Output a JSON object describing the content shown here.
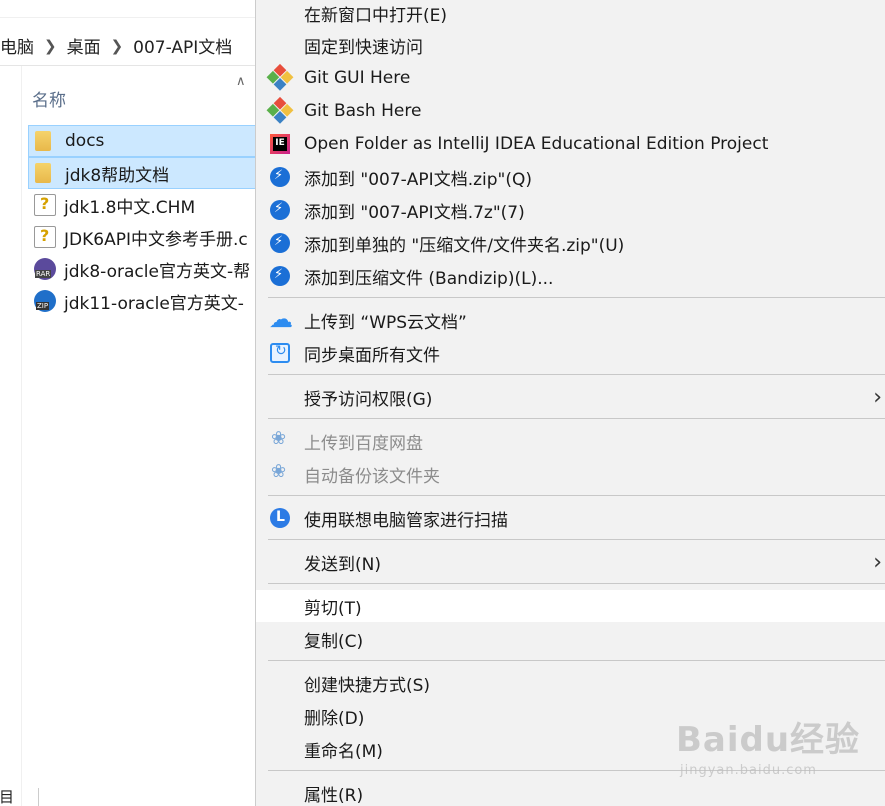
{
  "explorer": {
    "breadcrumb": [
      "电脑",
      "桌面",
      "007-API文档"
    ],
    "column_header": "名称",
    "files": [
      {
        "name": "docs",
        "icon": "folder-icon",
        "selected": true
      },
      {
        "name": "jdk8帮助文档",
        "icon": "folder-icon",
        "selected": true
      },
      {
        "name": "jdk1.8中文.CHM",
        "icon": "chm-file-icon",
        "selected": false
      },
      {
        "name": "JDK6API中文参考手册.c",
        "icon": "chm-file-icon",
        "selected": false
      },
      {
        "name": "jdk8-oracle官方英文-帮",
        "icon": "rar-file-icon",
        "selected": false
      },
      {
        "name": "jdk11-oracle官方英文-",
        "icon": "zip-file-icon",
        "selected": false
      }
    ],
    "status_fragment": "项目"
  },
  "context_menu": {
    "items": [
      {
        "label": "在新窗口中打开(E)",
        "icon": "",
        "disabled": false
      },
      {
        "label": "固定到快速访问",
        "icon": "",
        "disabled": false
      },
      {
        "label": "Git GUI Here",
        "icon": "git-icon",
        "disabled": false
      },
      {
        "label": "Git Bash Here",
        "icon": "git-icon",
        "disabled": false
      },
      {
        "label": "Open Folder as IntelliJ IDEA Educational Edition Project",
        "icon": "intellij-icon",
        "disabled": false
      },
      {
        "label": "添加到 \"007-API文档.zip\"(Q)",
        "icon": "bandizip-icon",
        "disabled": false
      },
      {
        "label": "添加到 \"007-API文档.7z\"(7)",
        "icon": "bandizip-icon",
        "disabled": false
      },
      {
        "label": "添加到单独的 \"压缩文件/文件夹名.zip\"(U)",
        "icon": "bandizip-icon",
        "disabled": false
      },
      {
        "label": "添加到压缩文件 (Bandizip)(L)...",
        "icon": "bandizip-icon",
        "disabled": false
      },
      {
        "label": "上传到 “WPS云文档”",
        "icon": "cloud-upload-icon",
        "disabled": false
      },
      {
        "label": "同步桌面所有文件",
        "icon": "sync-icon",
        "disabled": false
      },
      {
        "label": "授予访问权限(G)",
        "icon": "",
        "disabled": false,
        "submenu": true
      },
      {
        "label": "上传到百度网盘",
        "icon": "baidu-netdisk-icon",
        "disabled": true
      },
      {
        "label": "自动备份该文件夹",
        "icon": "baidu-netdisk-icon",
        "disabled": true
      },
      {
        "label": "使用联想电脑管家进行扫描",
        "icon": "lenovo-icon",
        "disabled": false
      },
      {
        "label": "发送到(N)",
        "icon": "",
        "disabled": false,
        "submenu": true
      },
      {
        "label": "剪切(T)",
        "icon": "",
        "disabled": false,
        "hover": true
      },
      {
        "label": "复制(C)",
        "icon": "",
        "disabled": false
      },
      {
        "label": "创建快捷方式(S)",
        "icon": "",
        "disabled": false
      },
      {
        "label": "删除(D)",
        "icon": "",
        "disabled": false
      },
      {
        "label": "重命名(M)",
        "icon": "",
        "disabled": false
      },
      {
        "label": "属性(R)",
        "icon": "",
        "disabled": false
      }
    ],
    "submenu_arrow": "›"
  },
  "watermark": {
    "main": "Baidu经验",
    "sub": "jingyan.baidu.com"
  }
}
